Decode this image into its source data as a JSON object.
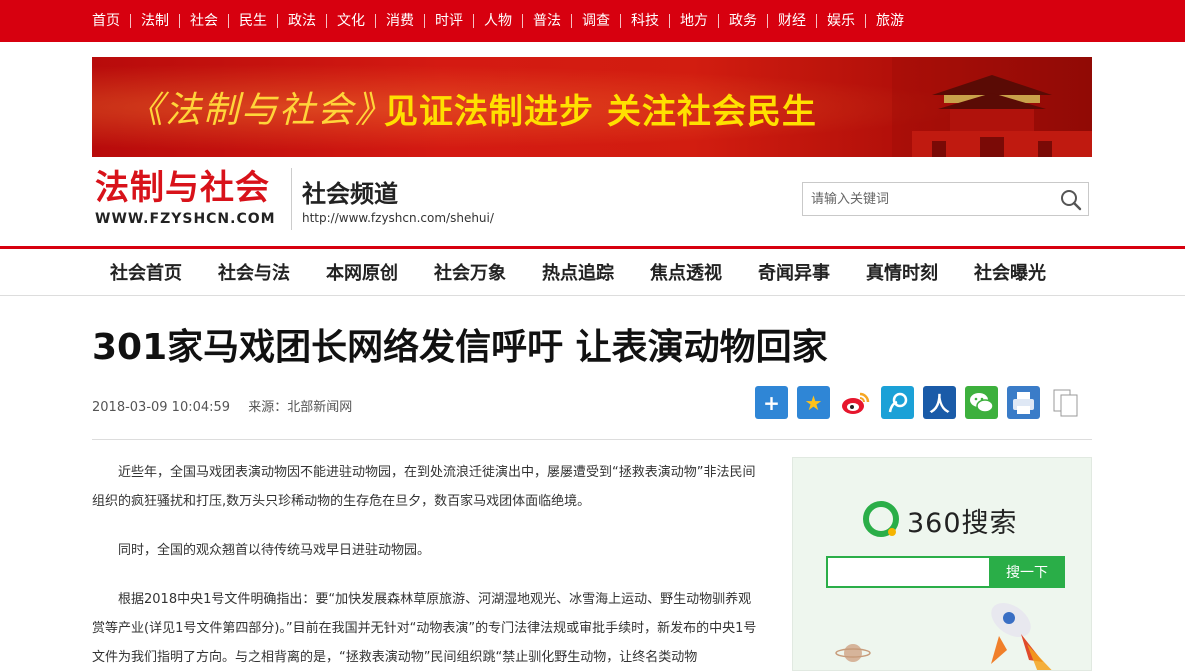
{
  "top_nav": [
    "首页",
    "法制",
    "社会",
    "民生",
    "政法",
    "文化",
    "消费",
    "时评",
    "人物",
    "普法",
    "调查",
    "科技",
    "地方",
    "政务",
    "财经",
    "娱乐",
    "旅游"
  ],
  "banner": {
    "magazine": "《法制与社会》",
    "slogan": "见证法制进步 关注社会民生"
  },
  "logo": {
    "cn": "法制与社会",
    "en": "WWW.FZYSHCN.COM"
  },
  "channel": {
    "title": "社会频道",
    "url": "http://www.fzyshcn.com/shehui/"
  },
  "search": {
    "placeholder": "请输入关键词"
  },
  "channel_nav": [
    "社会首页",
    "社会与法",
    "本网原创",
    "社会万象",
    "热点追踪",
    "焦点透视",
    "奇闻异事",
    "真情时刻",
    "社会曝光"
  ],
  "article": {
    "title": "301家马戏团长网络发信呼吁 让表演动物回家",
    "datetime": "2018-03-09 10:04:59",
    "source": "来源：北部新闻网",
    "paragraphs": [
      "近些年，全国马戏团表演动物因不能进驻动物园，在到处流浪迁徙演出中，屡屡遭受到“拯救表演动物”非法民间组织的疯狂骚扰和打压,数万头只珍稀动物的生存危在旦夕，数百家马戏团体面临绝境。",
      "同时，全国的观众翘首以待传统马戏早日进驻动物园。",
      "根据2018中央1号文件明确指出：要“加快发展森林草原旅游、河湖湿地观光、冰雪海上运动、野生动物驯养观赏等产业(详见1号文件第四部分)。”目前在我国并无针对“动物表演”的专门法律法规或审批手续时，新发布的中央1号文件为我们指明了方向。与之相背离的是，“拯救表演动物”民间组织跳“禁止驯化野生动物，让终名类动物"
    ]
  },
  "share_icons": [
    {
      "name": "share-more-icon",
      "color": "#2f86d6",
      "glyph": "+"
    },
    {
      "name": "qzone-icon",
      "color": "#2f86d6",
      "glyph": "★"
    },
    {
      "name": "weibo-icon",
      "color": "#ffffff",
      "glyph": ""
    },
    {
      "name": "tencent-weibo-icon",
      "color": "#1ba1d7",
      "glyph": ""
    },
    {
      "name": "renren-icon",
      "color": "#1a5ba8",
      "glyph": "人"
    },
    {
      "name": "wechat-icon",
      "color": "#3db03d",
      "glyph": ""
    },
    {
      "name": "print-icon",
      "color": "#3a7cc8",
      "glyph": ""
    },
    {
      "name": "copy-icon",
      "color": "#ffffff",
      "glyph": ""
    }
  ],
  "ad": {
    "brand": "360搜索",
    "button": "搜一下"
  }
}
